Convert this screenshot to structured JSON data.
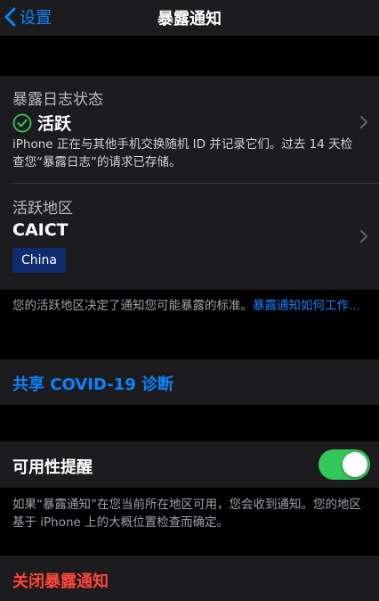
{
  "nav": {
    "back_label": "设置",
    "title": "暴露通知"
  },
  "exposure_log": {
    "heading": "暴露日志状态",
    "status_label": "活跃",
    "description": "iPhone 正在与其他手机交换随机 ID 并记录它们。过去 14 天检查您“暴露日志”的请求已存储。"
  },
  "active_region": {
    "heading": "活跃地区",
    "name": "CAICT",
    "badge": "China"
  },
  "region_footer": {
    "text": "您的活跃地区决定了通知您可能暴露的标准。",
    "link": "暴露通知如何工作..."
  },
  "share": {
    "label": "共享 COVID-19 诊断"
  },
  "availability": {
    "label": "可用性提醒",
    "enabled": true,
    "footer": "如果“暴露通知”在您当前所在地区可用，您会收到通知。您的地区基于 iPhone 上的大概位置检查而确定。"
  },
  "turn_off": {
    "label": "关闭暴露通知"
  },
  "colors": {
    "accent": "#0a84ff",
    "destructive": "#ff453a",
    "switch_on": "#34c759",
    "badge": "#0f2a6e"
  },
  "icons": {
    "back": "chevron-left-icon",
    "status": "checkmark-circle-icon",
    "disclosure": "chevron-right-icon"
  }
}
